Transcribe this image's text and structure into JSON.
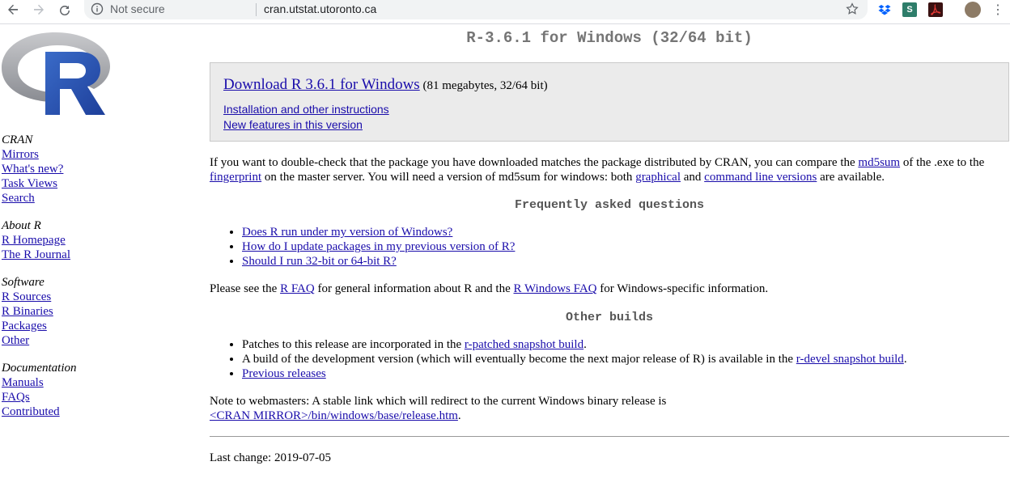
{
  "browser": {
    "security_label": "Not secure",
    "url": "cran.utstat.utoronto.ca"
  },
  "sidebar": {
    "groups": [
      {
        "heading": "CRAN",
        "links": [
          "Mirrors",
          "What's new?",
          "Task Views",
          "Search"
        ]
      },
      {
        "heading": "About R",
        "links": [
          "R Homepage",
          "The R Journal"
        ]
      },
      {
        "heading": "Software",
        "links": [
          "R Sources",
          "R Binaries",
          "Packages",
          "Other"
        ]
      },
      {
        "heading": "Documentation",
        "links": [
          "Manuals",
          "FAQs",
          "Contributed"
        ]
      }
    ]
  },
  "main": {
    "title": "R-3.6.1 for Windows (32/64 bit)",
    "download": {
      "link": "Download R 3.6.1 for Windows",
      "size": " (81 megabytes, 32/64 bit)",
      "install_link": "Installation and other instructions",
      "features_link": "New features in this version"
    },
    "verify": {
      "t1": "If you want to double-check that the package you have downloaded matches the package distributed by CRAN, you can compare the ",
      "md5": "md5sum",
      "t2": " of the .exe to the ",
      "fingerprint": "fingerprint",
      "t3": " on the master server. You will need a version of md5sum for windows: both ",
      "graphical": "graphical",
      "t4": " and ",
      "cmdline": "command line versions",
      "t5": " are available."
    },
    "faq_heading": "Frequently asked questions",
    "faq_items": [
      "Does R run under my version of Windows?",
      "How do I update packages in my previous version of R?",
      "Should I run 32-bit or 64-bit R?"
    ],
    "rfaq": {
      "t1": "Please see the ",
      "rfaq": "R FAQ",
      "t2": " for general information about R and the ",
      "winfaq": "R Windows FAQ",
      "t3": " for Windows-specific information."
    },
    "other_heading": "Other builds",
    "builds": {
      "b1_text": "Patches to this release are incorporated in the ",
      "b1_link": "r-patched snapshot build",
      "b2_text": "A build of the development version (which will eventually become the next major release of R) is available in the ",
      "b2_link": "r-devel snapshot build",
      "b3_link": "Previous releases"
    },
    "note": {
      "text": "Note to webmasters: A stable link which will redirect to the current Windows binary release is",
      "link": "<CRAN MIRROR>/bin/windows/base/release.htm"
    },
    "last_change": "Last change: 2019-07-05"
  }
}
